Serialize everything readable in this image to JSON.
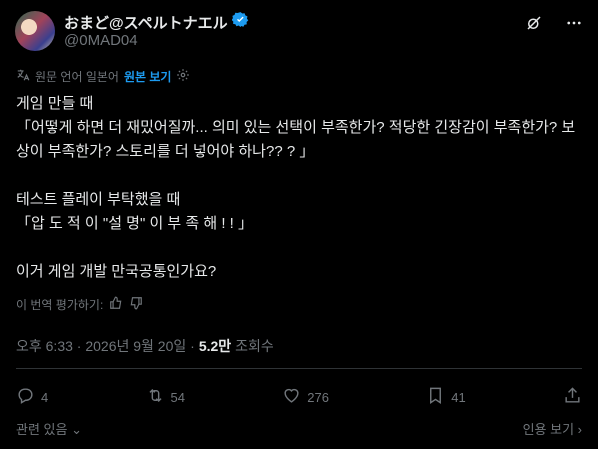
{
  "author": {
    "display_name": "おまど@スペルトナエル",
    "handle": "@0MAD04",
    "verified": true
  },
  "translate": {
    "source": "원문 언어 일본어",
    "show_original": "원본 보기"
  },
  "post": {
    "lines": [
      "게임 만들 때",
      "「어떻게 하면 더 재밌어질까... 의미 있는 선택이 부족한가? 적당한 긴장감이 부족한가? 보상이 부족한가? 스토리를 더 넣어야 하나?? ? 」",
      "",
      "테스트 플레이 부탁했을 때",
      "「압 도 적 이 \"설 명\" 이 부 족 해 ! ! 」",
      "",
      "이거 게임 개발 만국공통인가요?"
    ]
  },
  "rate_translation": "이 번역 평가하기:",
  "meta": {
    "time": "오후 6:33 · 2026년 9월 20일 · ",
    "views_count": "5.2만",
    "views_label": "조회수"
  },
  "actions": {
    "replies": "4",
    "reposts": "54",
    "likes": "276",
    "bookmarks": "41"
  },
  "footer": {
    "related": "관련 있음",
    "quote": "인용 보기"
  },
  "colors": {
    "accent": "#1d9bf0",
    "muted": "#71767b",
    "text": "#e7e9ea",
    "background": "#000000"
  }
}
